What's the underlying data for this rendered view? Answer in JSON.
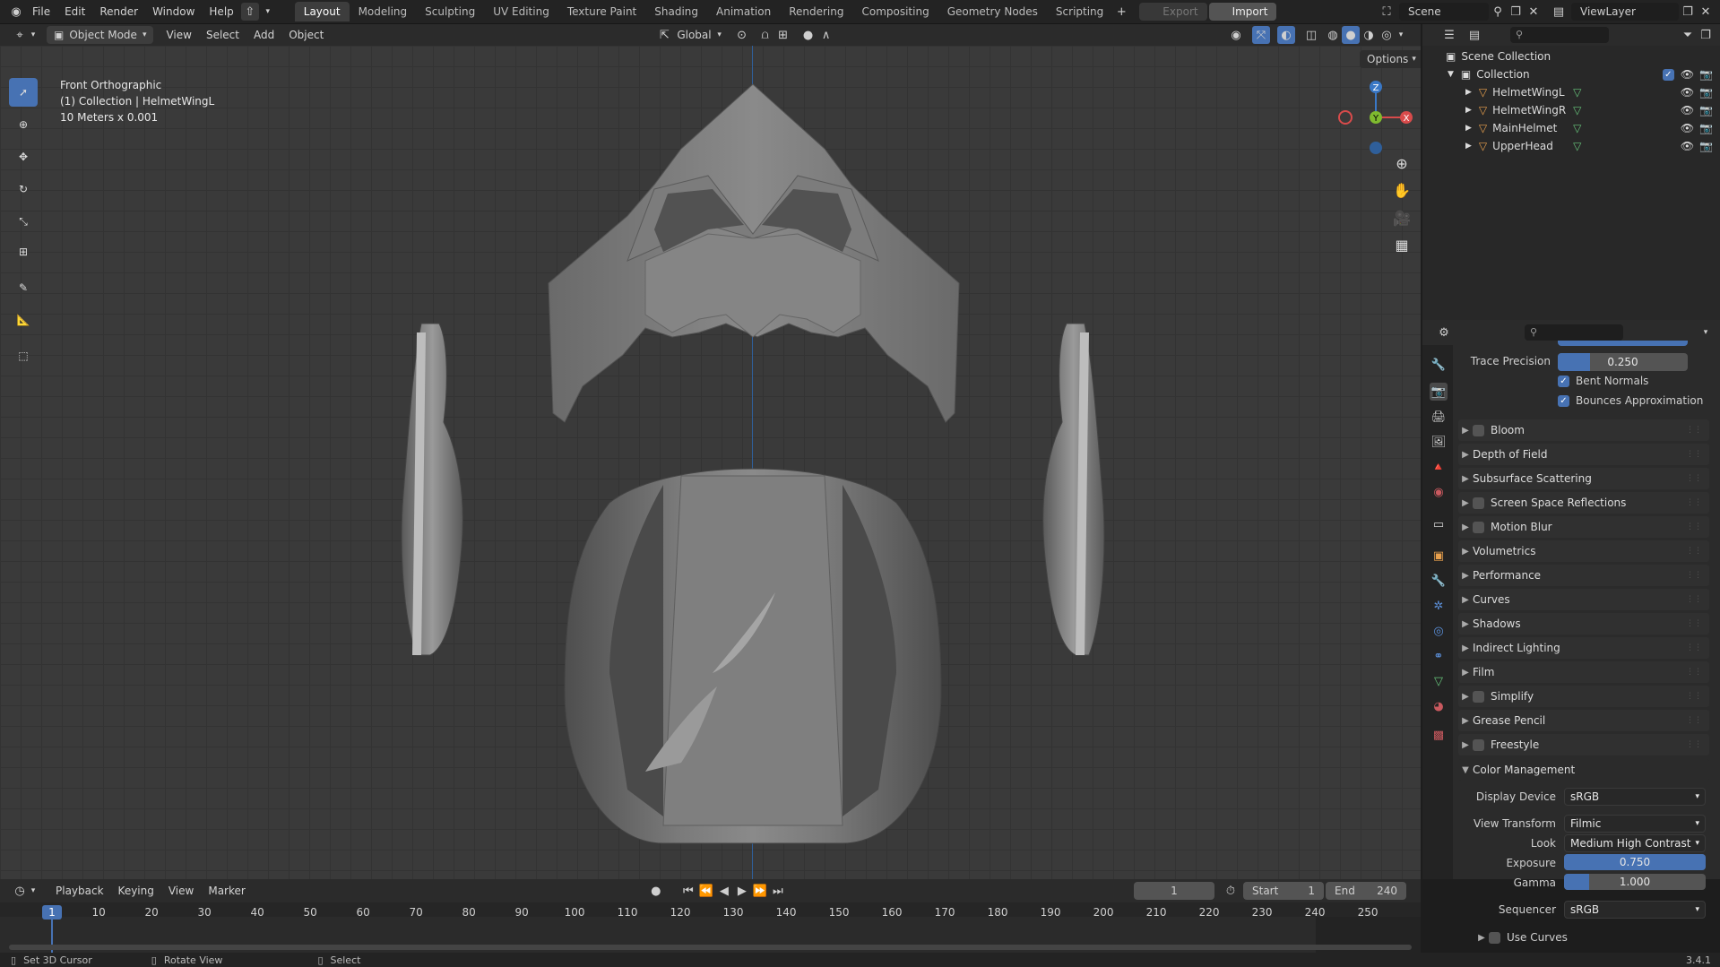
{
  "topbar": {
    "menus": [
      "File",
      "Edit",
      "Render",
      "Window",
      "Help"
    ],
    "workspaces": [
      "Layout",
      "Modeling",
      "Sculpting",
      "UV Editing",
      "Texture Paint",
      "Shading",
      "Animation",
      "Rendering",
      "Compositing",
      "Geometry Nodes",
      "Scripting"
    ],
    "active_workspace": "Layout",
    "export_label": "Export",
    "import_label": "Import",
    "scene_name": "Scene",
    "view_layer": "ViewLayer"
  },
  "viewport_header": {
    "mode": "Object Mode",
    "menus": [
      "View",
      "Select",
      "Add",
      "Object"
    ],
    "orientation": "Global",
    "options_label": "Options"
  },
  "viewport": {
    "view_name": "Front Orthographic",
    "collection_info": "(1) Collection | HelmetWingL",
    "scale_info": "10 Meters x 0.001",
    "gizmo_axes": [
      "Z",
      "Y",
      "X"
    ]
  },
  "outliner": {
    "root": "Scene Collection",
    "collection": "Collection",
    "objects": [
      "HelmetWingL",
      "HelmetWingR",
      "MainHelmet",
      "UpperHead"
    ]
  },
  "properties": {
    "trace_precision_label": "Trace Precision",
    "trace_precision_value": "0.250",
    "bent_normals": "Bent Normals",
    "bounces_approx": "Bounces Approximation",
    "panels": [
      {
        "label": "Bloom",
        "checkbox": true
      },
      {
        "label": "Depth of Field",
        "checkbox": false
      },
      {
        "label": "Subsurface Scattering",
        "checkbox": false
      },
      {
        "label": "Screen Space Reflections",
        "checkbox": true
      },
      {
        "label": "Motion Blur",
        "checkbox": true
      },
      {
        "label": "Volumetrics",
        "checkbox": false
      },
      {
        "label": "Performance",
        "checkbox": false
      },
      {
        "label": "Curves",
        "checkbox": false
      },
      {
        "label": "Shadows",
        "checkbox": false
      },
      {
        "label": "Indirect Lighting",
        "checkbox": false
      },
      {
        "label": "Film",
        "checkbox": false
      },
      {
        "label": "Simplify",
        "checkbox": true
      },
      {
        "label": "Grease Pencil",
        "checkbox": false
      },
      {
        "label": "Freestyle",
        "checkbox": true
      }
    ],
    "color_management": {
      "title": "Color Management",
      "display_device_label": "Display Device",
      "display_device": "sRGB",
      "view_transform_label": "View Transform",
      "view_transform": "Filmic",
      "look_label": "Look",
      "look": "Medium High Contrast",
      "exposure_label": "Exposure",
      "exposure": "0.750",
      "gamma_label": "Gamma",
      "gamma": "1.000",
      "sequencer_label": "Sequencer",
      "sequencer": "sRGB",
      "use_curves": "Use Curves"
    }
  },
  "timeline": {
    "menus": [
      "Playback",
      "Keying",
      "View",
      "Marker"
    ],
    "current_frame": "1",
    "start_label": "Start",
    "start": "1",
    "end_label": "End",
    "end": "240",
    "ticks": [
      "10",
      "20",
      "30",
      "40",
      "50",
      "60",
      "70",
      "80",
      "90",
      "100",
      "110",
      "120",
      "130",
      "140",
      "150",
      "160",
      "170",
      "180",
      "190",
      "200",
      "210",
      "220",
      "230",
      "240",
      "250"
    ]
  },
  "statusbar": {
    "hint1": "Set 3D Cursor",
    "hint2": "Rotate View",
    "hint3": "Select",
    "version": "3.4.1"
  }
}
